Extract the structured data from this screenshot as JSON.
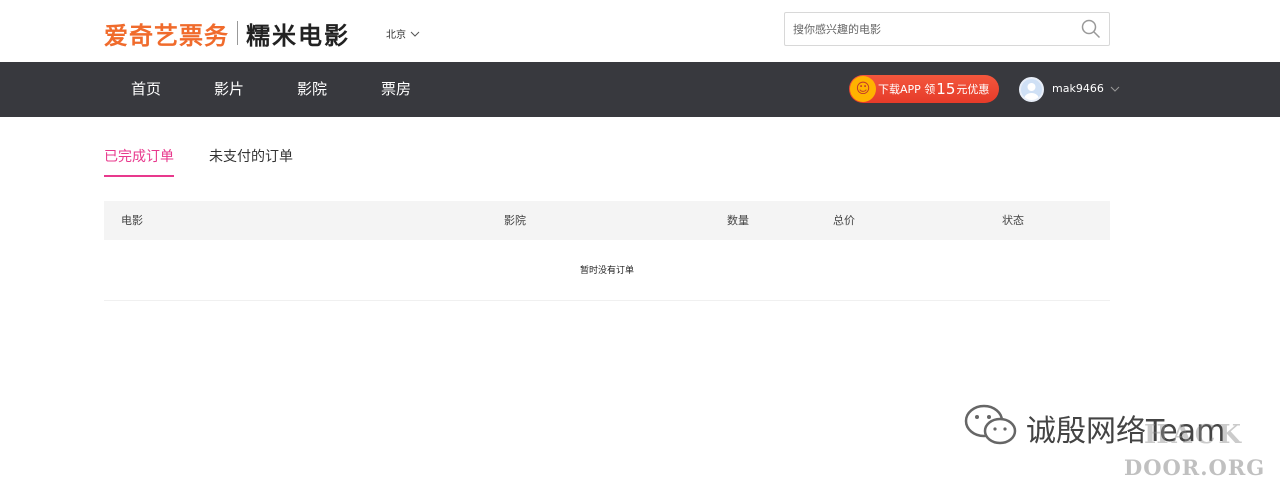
{
  "header": {
    "brand": "爱奇艺票务",
    "sub_brand": "糯米电影",
    "city": "北京",
    "search_placeholder": "搜你感兴趣的电影"
  },
  "nav": {
    "items": [
      "首页",
      "影片",
      "影院",
      "票房"
    ],
    "app_banner": {
      "prefix": "下载APP 领",
      "amount": "15",
      "suffix": "元优惠"
    },
    "username": "mak9466"
  },
  "tabs": [
    {
      "label": "已完成订单",
      "active": true
    },
    {
      "label": "未支付的订单",
      "active": false
    }
  ],
  "table": {
    "columns": [
      "电影",
      "影院",
      "数量",
      "总价",
      "状态"
    ],
    "empty_text": "暂时没有订单"
  },
  "watermark": {
    "text": "诚殷网络Team",
    "site_line1": "HACK",
    "site_line2": "DOOR.ORG"
  },
  "colors": {
    "brand_orange": "#f06b2c",
    "nav_bg": "#38393e",
    "active_tab": "#e8398d",
    "banner_red": "#e63b29"
  }
}
